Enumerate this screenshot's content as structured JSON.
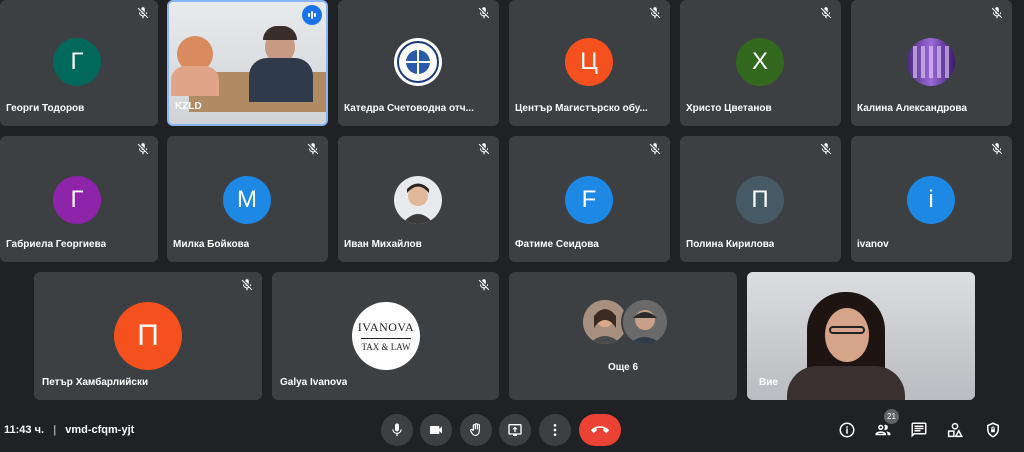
{
  "participants": [
    {
      "name": "Георги Тодоров",
      "initial": "Г",
      "color": "#00695c"
    },
    {
      "name": "KZLD",
      "initial": "",
      "color": ""
    },
    {
      "name": "Катедра Счетоводна отч...",
      "initial": "",
      "color": ""
    },
    {
      "name": "Център Магистърско обу...",
      "initial": "Ц",
      "color": "#f4511e"
    },
    {
      "name": "Христо Цветанов",
      "initial": "Х",
      "color": "#33691e"
    },
    {
      "name": "Калина Александрова",
      "initial": "",
      "color": ""
    },
    {
      "name": "Габриела Георгиева",
      "initial": "Г",
      "color": "#8e24aa"
    },
    {
      "name": "Милка Бойкова",
      "initial": "М",
      "color": "#1e88e5"
    },
    {
      "name": "Иван Михайлов",
      "initial": "",
      "color": ""
    },
    {
      "name": "Фатиме Сеидова",
      "initial": "F",
      "color": "#1e88e5"
    },
    {
      "name": "Полина Кирилова",
      "initial": "П",
      "color": "#455a64"
    },
    {
      "name": "ivanov",
      "initial": "i",
      "color": "#1e88e5"
    },
    {
      "name": "Петър Хамбарлийски",
      "initial": "П",
      "color": "#f4511e"
    },
    {
      "name": "Galya Ivanova",
      "initial": "",
      "color": ""
    },
    {
      "name": "Още 6",
      "initial": "",
      "color": ""
    },
    {
      "name": "Вие",
      "initial": "",
      "color": ""
    }
  ],
  "galya_logo": {
    "line1": "IVANOVA",
    "line2": "TAX & LAW"
  },
  "meeting": {
    "time": "11:43 ч.",
    "separator": "|",
    "code": "vmd-cfqm-yjt"
  },
  "people_count": "21",
  "icons": {
    "mic": "mic-icon",
    "camera": "camera-icon",
    "hand": "raise-hand-icon",
    "present": "present-icon",
    "more": "more-vert-icon",
    "end": "end-call-icon",
    "info": "info-icon",
    "people": "people-icon",
    "chat": "chat-icon",
    "activities": "activities-icon",
    "security": "security-icon"
  }
}
